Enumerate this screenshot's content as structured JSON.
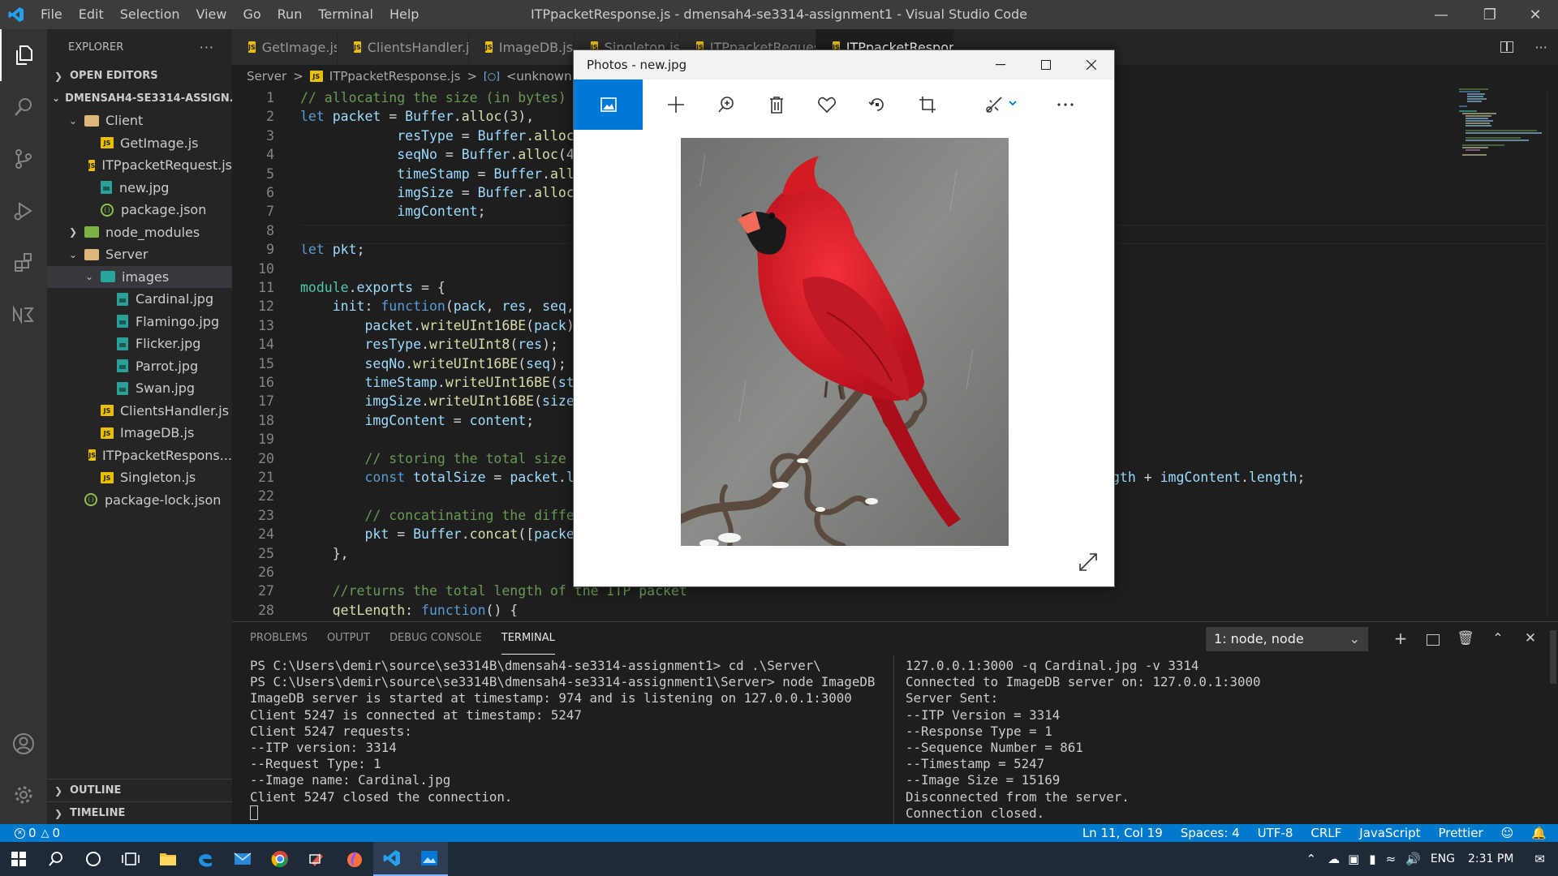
{
  "titlebar": {
    "menus": [
      "File",
      "Edit",
      "Selection",
      "View",
      "Go",
      "Run",
      "Terminal",
      "Help"
    ],
    "title": "ITPpacketResponse.js - dmensah4-se3314-assignment1 - Visual Studio Code"
  },
  "sidebar": {
    "header": "EXPLORER",
    "open_editors": "OPEN EDITORS",
    "project": "DMENSAH4-SE3314-ASSIGN...",
    "tree": [
      {
        "label": "Client",
        "type": "folder-open",
        "indent": 1
      },
      {
        "label": "GetImage.js",
        "type": "js",
        "indent": 2
      },
      {
        "label": "ITPpacketRequest.js",
        "type": "js",
        "indent": 2
      },
      {
        "label": "new.jpg",
        "type": "img",
        "indent": 2
      },
      {
        "label": "package.json",
        "type": "json",
        "indent": 2
      },
      {
        "label": "node_modules",
        "type": "folder-closed",
        "indent": 1
      },
      {
        "label": "Server",
        "type": "folder-open",
        "indent": 1
      },
      {
        "label": "images",
        "type": "folder-open-teal",
        "indent": 2
      },
      {
        "label": "Cardinal.jpg",
        "type": "img",
        "indent": 3
      },
      {
        "label": "Flamingo.jpg",
        "type": "img",
        "indent": 3
      },
      {
        "label": "Flicker.jpg",
        "type": "img",
        "indent": 3
      },
      {
        "label": "Parrot.jpg",
        "type": "img",
        "indent": 3
      },
      {
        "label": "Swan.jpg",
        "type": "img",
        "indent": 3
      },
      {
        "label": "ClientsHandler.js",
        "type": "js",
        "indent": 2
      },
      {
        "label": "ImageDB.js",
        "type": "js",
        "indent": 2
      },
      {
        "label": "ITPpacketRespons...",
        "type": "js",
        "indent": 2
      },
      {
        "label": "Singleton.js",
        "type": "js",
        "indent": 2
      },
      {
        "label": "package-lock.json",
        "type": "json",
        "indent": 1
      }
    ],
    "outline": "OUTLINE",
    "timeline": "TIMELINE"
  },
  "tabs": [
    {
      "label": "GetImage.js",
      "active": false
    },
    {
      "label": "ClientsHandler.js",
      "active": false
    },
    {
      "label": "ImageDB.js",
      "active": false
    },
    {
      "label": "Singleton.js",
      "active": false
    },
    {
      "label": "ITPpacketRequest.js",
      "active": false
    },
    {
      "label": "ITPpacketResponse.js",
      "active": true
    }
  ],
  "breadcrumb": [
    "Server",
    ">",
    "ITPpacketResponse.js",
    ">",
    "<unknown>"
  ],
  "code": [
    {
      "n": "1",
      "parts": [
        [
          "c-com",
          "// allocating the size (in bytes) o"
        ]
      ]
    },
    {
      "n": "2",
      "parts": [
        [
          "c-kw",
          "let "
        ],
        [
          "c-var",
          "packet"
        ],
        [
          "c-txt",
          " = "
        ],
        [
          "c-var",
          "Buffer"
        ],
        [
          "c-txt",
          "."
        ],
        [
          "c-fn",
          "alloc"
        ],
        [
          "c-txt",
          "("
        ],
        [
          "c-num",
          "3"
        ],
        [
          "c-txt",
          "),"
        ]
      ]
    },
    {
      "n": "3",
      "parts": [
        [
          "c-txt",
          "            "
        ],
        [
          "c-var",
          "resType"
        ],
        [
          "c-txt",
          " = "
        ],
        [
          "c-var",
          "Buffer"
        ],
        [
          "c-txt",
          "."
        ],
        [
          "c-fn",
          "alloc"
        ],
        [
          "c-txt",
          "("
        ]
      ]
    },
    {
      "n": "4",
      "parts": [
        [
          "c-txt",
          "            "
        ],
        [
          "c-var",
          "seqNo"
        ],
        [
          "c-txt",
          " = "
        ],
        [
          "c-var",
          "Buffer"
        ],
        [
          "c-txt",
          "."
        ],
        [
          "c-fn",
          "alloc"
        ],
        [
          "c-txt",
          "("
        ],
        [
          "c-num",
          "4"
        ],
        [
          "c-txt",
          ")"
        ]
      ]
    },
    {
      "n": "5",
      "parts": [
        [
          "c-txt",
          "            "
        ],
        [
          "c-var",
          "timeStamp"
        ],
        [
          "c-txt",
          " = "
        ],
        [
          "c-var",
          "Buffer"
        ],
        [
          "c-txt",
          "."
        ],
        [
          "c-fn",
          "allo"
        ]
      ]
    },
    {
      "n": "6",
      "parts": [
        [
          "c-txt",
          "            "
        ],
        [
          "c-var",
          "imgSize"
        ],
        [
          "c-txt",
          " = "
        ],
        [
          "c-var",
          "Buffer"
        ],
        [
          "c-txt",
          "."
        ],
        [
          "c-fn",
          "alloc"
        ],
        [
          "c-txt",
          "("
        ]
      ]
    },
    {
      "n": "7",
      "parts": [
        [
          "c-txt",
          "            "
        ],
        [
          "c-var",
          "imgContent"
        ],
        [
          "c-txt",
          ";"
        ]
      ]
    },
    {
      "n": "8",
      "parts": []
    },
    {
      "n": "9",
      "parts": [
        [
          "c-kw",
          "let "
        ],
        [
          "c-var",
          "pkt"
        ],
        [
          "c-txt",
          ";"
        ]
      ]
    },
    {
      "n": "10",
      "parts": []
    },
    {
      "n": "11",
      "parts": [
        [
          "c-cls",
          "module"
        ],
        [
          "c-txt",
          "."
        ],
        [
          "c-var",
          "exports"
        ],
        [
          "c-txt",
          " = {"
        ]
      ]
    },
    {
      "n": "12",
      "parts": [
        [
          "c-txt",
          "    "
        ],
        [
          "c-var",
          "init"
        ],
        [
          "c-txt",
          ": "
        ],
        [
          "c-kw",
          "function"
        ],
        [
          "c-txt",
          "("
        ],
        [
          "c-var",
          "pack"
        ],
        [
          "c-txt",
          ", "
        ],
        [
          "c-var",
          "res"
        ],
        [
          "c-txt",
          ", "
        ],
        [
          "c-var",
          "seq"
        ],
        [
          "c-txt",
          ","
        ]
      ]
    },
    {
      "n": "13",
      "parts": [
        [
          "c-txt",
          "        "
        ],
        [
          "c-var",
          "packet"
        ],
        [
          "c-txt",
          "."
        ],
        [
          "c-fn",
          "writeUInt16BE"
        ],
        [
          "c-txt",
          "("
        ],
        [
          "c-var",
          "pack"
        ],
        [
          "c-txt",
          ");"
        ]
      ]
    },
    {
      "n": "14",
      "parts": [
        [
          "c-txt",
          "        "
        ],
        [
          "c-var",
          "resType"
        ],
        [
          "c-txt",
          "."
        ],
        [
          "c-fn",
          "writeUInt8"
        ],
        [
          "c-txt",
          "("
        ],
        [
          "c-var",
          "res"
        ],
        [
          "c-txt",
          ");"
        ]
      ]
    },
    {
      "n": "15",
      "parts": [
        [
          "c-txt",
          "        "
        ],
        [
          "c-var",
          "seqNo"
        ],
        [
          "c-txt",
          "."
        ],
        [
          "c-fn",
          "writeUInt16BE"
        ],
        [
          "c-txt",
          "("
        ],
        [
          "c-var",
          "seq"
        ],
        [
          "c-txt",
          ");"
        ]
      ]
    },
    {
      "n": "16",
      "parts": [
        [
          "c-txt",
          "        "
        ],
        [
          "c-var",
          "timeStamp"
        ],
        [
          "c-txt",
          "."
        ],
        [
          "c-fn",
          "writeUInt16BE"
        ],
        [
          "c-txt",
          "("
        ],
        [
          "c-var",
          "sta"
        ]
      ]
    },
    {
      "n": "17",
      "parts": [
        [
          "c-txt",
          "        "
        ],
        [
          "c-var",
          "imgSize"
        ],
        [
          "c-txt",
          "."
        ],
        [
          "c-fn",
          "writeUInt16BE"
        ],
        [
          "c-txt",
          "("
        ],
        [
          "c-var",
          "size"
        ],
        [
          "c-txt",
          ")"
        ]
      ]
    },
    {
      "n": "18",
      "parts": [
        [
          "c-txt",
          "        "
        ],
        [
          "c-var",
          "imgContent"
        ],
        [
          "c-txt",
          " = "
        ],
        [
          "c-var",
          "content"
        ],
        [
          "c-txt",
          ";"
        ]
      ]
    },
    {
      "n": "19",
      "parts": []
    },
    {
      "n": "20",
      "parts": [
        [
          "c-txt",
          "        "
        ],
        [
          "c-com",
          "// storing the total size o"
        ]
      ]
    },
    {
      "n": "21",
      "parts": [
        [
          "c-txt",
          "        "
        ],
        [
          "c-kw",
          "const "
        ],
        [
          "c-var",
          "totalSize"
        ],
        [
          "c-txt",
          " = "
        ],
        [
          "c-var",
          "packet"
        ],
        [
          "c-txt",
          "."
        ],
        [
          "c-var",
          "le"
        ]
      ]
    },
    {
      "n": "22",
      "parts": []
    },
    {
      "n": "23",
      "parts": [
        [
          "c-txt",
          "        "
        ],
        [
          "c-com",
          "// concatinating the differ"
        ]
      ]
    },
    {
      "n": "24",
      "parts": [
        [
          "c-txt",
          "        "
        ],
        [
          "c-var",
          "pkt"
        ],
        [
          "c-txt",
          " = "
        ],
        [
          "c-var",
          "Buffer"
        ],
        [
          "c-txt",
          "."
        ],
        [
          "c-fn",
          "concat"
        ],
        [
          "c-txt",
          "(["
        ],
        [
          "c-var",
          "packet"
        ]
      ]
    },
    {
      "n": "25",
      "parts": [
        [
          "c-txt",
          "    },"
        ]
      ]
    },
    {
      "n": "26",
      "parts": []
    },
    {
      "n": "27",
      "parts": [
        [
          "c-txt",
          "    "
        ],
        [
          "c-com",
          "//returns the total length of the ITP packet"
        ]
      ]
    },
    {
      "n": "28",
      "parts": [
        [
          "c-txt",
          "    "
        ],
        [
          "c-fn",
          "getLength"
        ],
        [
          "c-txt",
          ": "
        ],
        [
          "c-kw",
          "function"
        ],
        [
          "c-txt",
          "() {"
        ]
      ]
    }
  ],
  "code_line21_tail": [
    [
      "c-var",
      "gth"
    ],
    [
      "c-txt",
      " + "
    ],
    [
      "c-var",
      "imgContent"
    ],
    [
      "c-txt",
      "."
    ],
    [
      "c-var",
      "length"
    ],
    [
      "c-txt",
      ";"
    ]
  ],
  "panel": {
    "tabs": [
      "PROBLEMS",
      "OUTPUT",
      "DEBUG CONSOLE",
      "TERMINAL"
    ],
    "active_tab": "TERMINAL",
    "terminal_select": "1: node, node",
    "left_terminal": [
      "PS C:\\Users\\demir\\source\\se3314B\\dmensah4-se3314-assignment1> cd .\\Server\\",
      "PS C:\\Users\\demir\\source\\se3314B\\dmensah4-se3314-assignment1\\Server> node ImageDB",
      "ImageDB server is started at timestamp: 974 and is listening on 127.0.0.1:3000",
      "Client 5247 is connected at timestamp: 5247",
      "Client 5247 requests:",
      "--ITP version: 3314",
      "--Request Type: 1",
      "--Image name: Cardinal.jpg",
      "Client 5247 closed the connection."
    ],
    "right_terminal": [
      "127.0.0.1:3000 -q Cardinal.jpg -v 3314",
      "Connected to ImageDB server on: 127.0.0.1:3000",
      "Server Sent:",
      "--ITP Version = 3314",
      "--Response Type = 1",
      "--Sequence Number = 861",
      "--Timestamp = 5247",
      "--Image Size = 15169",
      "Disconnected from the server.",
      "Connection closed."
    ]
  },
  "statusbar": {
    "errors": "0",
    "warnings": "0",
    "position": "Ln 11, Col 19",
    "spaces": "Spaces: 4",
    "encoding": "UTF-8",
    "eol": "CRLF",
    "language": "JavaScript",
    "formatter": "Prettier"
  },
  "photos": {
    "title": "Photos - new.jpg",
    "tools": [
      "add-icon",
      "zoom-icon",
      "delete-icon",
      "heart-icon",
      "rotate-icon",
      "crop-icon",
      "edit-icon",
      "more-icon"
    ]
  },
  "taskbar": {
    "lang": "ENG",
    "time": "2:31 PM"
  },
  "colors": {
    "accent": "#007acc",
    "photos_accent": "#0078d7",
    "titlebar": "#3c3c3c",
    "editor_bg": "#1e1e1e"
  }
}
